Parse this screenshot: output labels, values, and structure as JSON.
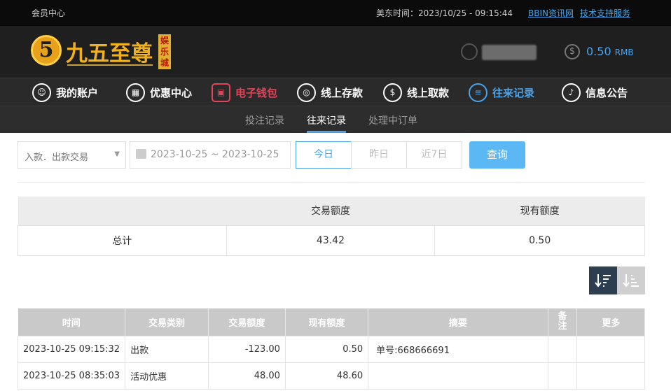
{
  "topbar": {
    "member_center": "会员中心",
    "time_label": "美东时间：2023/10/25 - 09:15:44",
    "link_bbin": "BBIN资讯网",
    "link_support": "技术支持服务"
  },
  "header": {
    "logo_mark": "5",
    "logo_text": "九五至尊",
    "logo_badge": "娱乐城",
    "balance_amount": "0.50",
    "balance_currency": "RMB"
  },
  "nav": {
    "items": [
      {
        "label": "我的账户",
        "icon": "user-icon"
      },
      {
        "label": "优惠中心",
        "icon": "gift-icon"
      },
      {
        "label": "电子钱包",
        "icon": "wallet-icon"
      },
      {
        "label": "线上存款",
        "icon": "deposit-icon"
      },
      {
        "label": "线上取款",
        "icon": "withdraw-icon"
      },
      {
        "label": "往来记录",
        "icon": "records-icon"
      },
      {
        "label": "信息公告",
        "icon": "bell-icon"
      }
    ]
  },
  "subnav": {
    "items": [
      "投注记录",
      "往来记录",
      "处理中订单"
    ],
    "active": "往来记录"
  },
  "filter": {
    "type_select": "入款．出款交易",
    "date_range": "2023-10-25 ~ 2023-10-25",
    "today": "今日",
    "yesterday": "昨日",
    "last7": "近7日",
    "query": "查询"
  },
  "summary": {
    "headers": [
      "",
      "交易额度",
      "现有额度"
    ],
    "row": [
      "总计",
      "43.42",
      "0.50"
    ]
  },
  "records": {
    "headers": [
      "时间",
      "交易类别",
      "交易额度",
      "现有额度",
      "摘要",
      "备注",
      "更多"
    ],
    "rows": [
      [
        "2023-10-25 09:15:32",
        "出款",
        "-123.00",
        "0.50",
        "单号:668666691",
        "",
        ""
      ],
      [
        "2023-10-25 08:35:03",
        "活动优惠",
        "48.00",
        "48.60",
        "",
        "",
        ""
      ]
    ]
  },
  "colors": {
    "accent_blue": "#4aa3e8",
    "accent_red": "#e0455a",
    "gold": "#f0b020",
    "query_button": "#5bb8f5"
  }
}
